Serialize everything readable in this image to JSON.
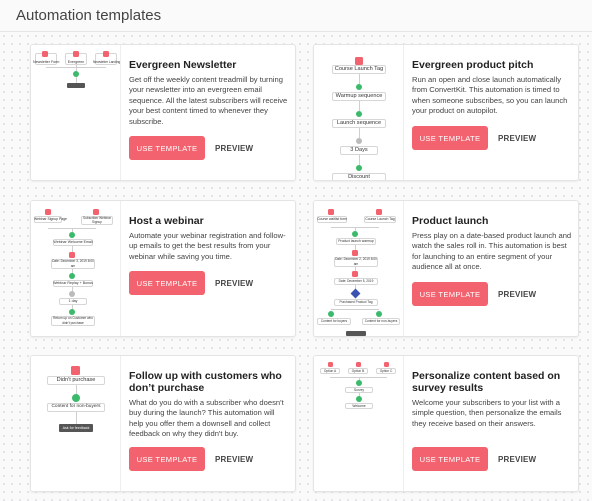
{
  "page": {
    "title": "Automation templates"
  },
  "accent_color": "#f2636f",
  "templates": [
    {
      "title": "Evergreen Newsletter",
      "description": "Get off the weekly content treadmill by turning your newsletter into an evergreen email sequence. All the latest subscribers will receive your best content timed to whenever they subscribe.",
      "use_label": "USE TEMPLATE",
      "preview_label": "PREVIEW",
      "diagram_labels": [
        "Newsletter Form",
        "Evergreen",
        "Newsletter Landing Page"
      ]
    },
    {
      "title": "Evergreen product pitch",
      "description": "Run an open and close launch automatically from ConvertKit. This automation is timed to when someone subscribes, so you can launch your product on autopilot.",
      "use_label": "USE TEMPLATE",
      "preview_label": "PREVIEW",
      "diagram_labels": [
        "Course Launch Tag",
        "Warmup sequence",
        "Launch sequence",
        "3 Days",
        "Discount"
      ]
    },
    {
      "title": "Host a webinar",
      "description": "Automate your webinar registration and follow-up emails to get the best results from your webinar while saving you time.",
      "use_label": "USE TEMPLATE",
      "preview_label": "PREVIEW",
      "diagram_labels": [
        "Webinar Signup Page",
        "Subscriber Webinar Signup",
        "Webinar Welcome Email",
        "Date: December 3, 2019 8:00 am",
        "Webinar Replay + Bonus",
        "1 day",
        "Return up on Customer who didn't purchase"
      ]
    },
    {
      "title": "Product launch",
      "description": "Press play on a date-based product launch and watch the sales roll in. This automation is best for launching to an entire segment of your audience all at once.",
      "use_label": "USE TEMPLATE",
      "preview_label": "PREVIEW",
      "diagram_labels": [
        "Course waitlist form",
        "Course Launch Tag",
        "Product launch warmup",
        "Date: December 2, 2019 8:00 am",
        "Date: December 5, 2019",
        "Purchased Product Tag",
        "Content for buyers",
        "Content for non-buyers"
      ]
    },
    {
      "title": "Follow up with customers who don’t purchase",
      "description": "What do you do with a subscriber who doesn't buy during the launch? This automation will help you offer them a downsell and collect feedback on why they didn't buy.",
      "use_label": "USE TEMPLATE",
      "preview_label": "PREVIEW",
      "diagram_labels": [
        "Didn't purchase",
        "Content for non-buyers",
        "Ask for feedback"
      ]
    },
    {
      "title": "Personalize content based on survey results",
      "description": "Welcome your subscribers to your list with a simple question, then personalize the emails they receive based on their answers.",
      "use_label": "USE TEMPLATE",
      "preview_label": "PREVIEW",
      "diagram_labels": [
        "Option A",
        "Option B",
        "Option C",
        "Survey",
        "Welcome"
      ]
    }
  ]
}
